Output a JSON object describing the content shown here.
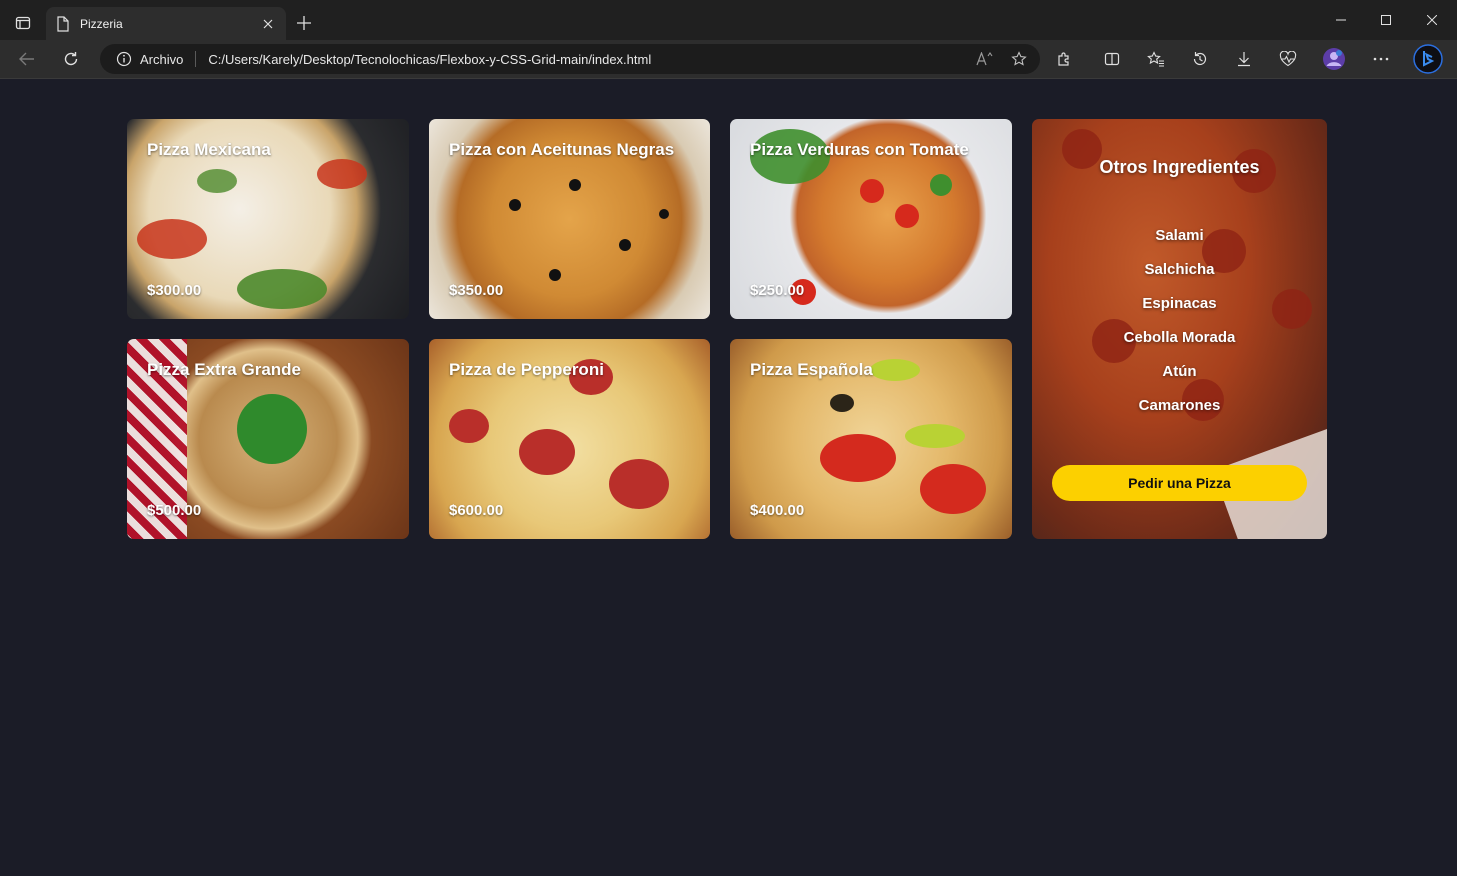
{
  "browser": {
    "tab_title": "Pizzeria",
    "address_prefix": "Archivo",
    "url": "C:/Users/Karely/Desktop/Tecnolochicas/Flexbox-y-CSS-Grid-main/index.html"
  },
  "pizzas": [
    {
      "name": "Pizza Mexicana",
      "price": "$300.00"
    },
    {
      "name": "Pizza con Aceitunas Negras",
      "price": "$350.00"
    },
    {
      "name": "Pizza Verduras con Tomate",
      "price": "$250.00"
    },
    {
      "name": "Pizza Extra Grande",
      "price": "$500.00"
    },
    {
      "name": "Pizza de Pepperoni",
      "price": "$600.00"
    },
    {
      "name": "Pizza Española",
      "price": "$400.00"
    }
  ],
  "sidebar": {
    "title": "Otros Ingredientes",
    "ingredients": [
      "Salami",
      "Salchicha",
      "Espinacas",
      "Cebolla Morada",
      "Atún",
      "Camarones"
    ],
    "order_button": "Pedir una Pizza"
  },
  "colors": {
    "page_background": "#1b1c27",
    "button": "#fcd000"
  }
}
